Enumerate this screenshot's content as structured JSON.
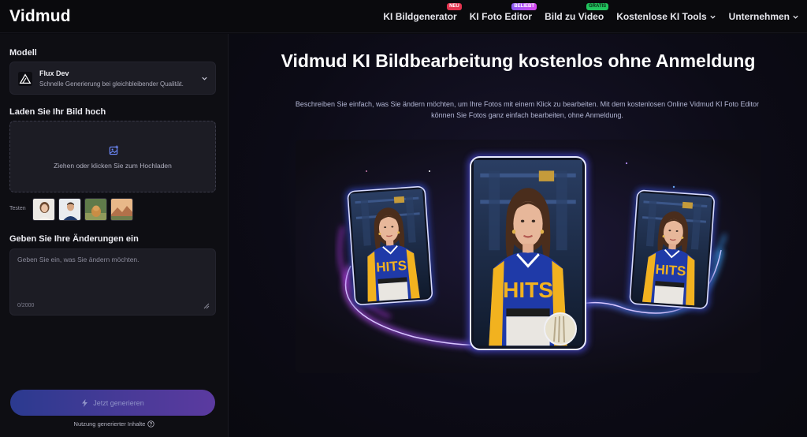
{
  "logo": "Vidmud",
  "nav": {
    "items": [
      {
        "label": "KI Bildgenerator",
        "badge": "NEU"
      },
      {
        "label": "KI Foto Editor",
        "badge": "BELIEBT"
      },
      {
        "label": "Bild zu Video",
        "badge": "GRATIS"
      },
      {
        "label": "Kostenlose KI Tools",
        "badge": ""
      },
      {
        "label": "Unternehmen",
        "badge": ""
      }
    ]
  },
  "sidebar": {
    "model_label": "Modell",
    "model_name": "Flux Dev",
    "model_desc": "Schnelle Generierung bei gleichbleibender Qualität.",
    "upload_label": "Laden Sie Ihr Bild hoch",
    "upload_text": "Ziehen oder klicken Sie zum Hochladen",
    "testen_label": "Testen",
    "prompt_label": "Geben Sie Ihre Änderungen ein",
    "prompt_placeholder": "Geben Sie ein, was Sie ändern möchten.",
    "prompt_counter": "0/2000",
    "generate_label": "Jetzt generieren",
    "usage_label": "Nutzung generierter Inhalte"
  },
  "main": {
    "title": "Vidmud KI Bildbearbeitung kostenlos ohne Anmeldung",
    "subtitle": "Beschreiben Sie einfach, was Sie ändern möchten, um Ihre Fotos mit einem Klick zu bearbeiten. Mit dem kostenlosen Online Vidmud KI Foto Editor können Sie Fotos ganz einfach bearbeiten, ohne Anmeldung.",
    "card_text": "HITS"
  },
  "colors": {
    "accent": "#5b3aa0",
    "neu": "#e2344f",
    "gratis": "#22c55e",
    "jacket_blue": "#1f3aa8",
    "jacket_yellow": "#f2b21f"
  }
}
